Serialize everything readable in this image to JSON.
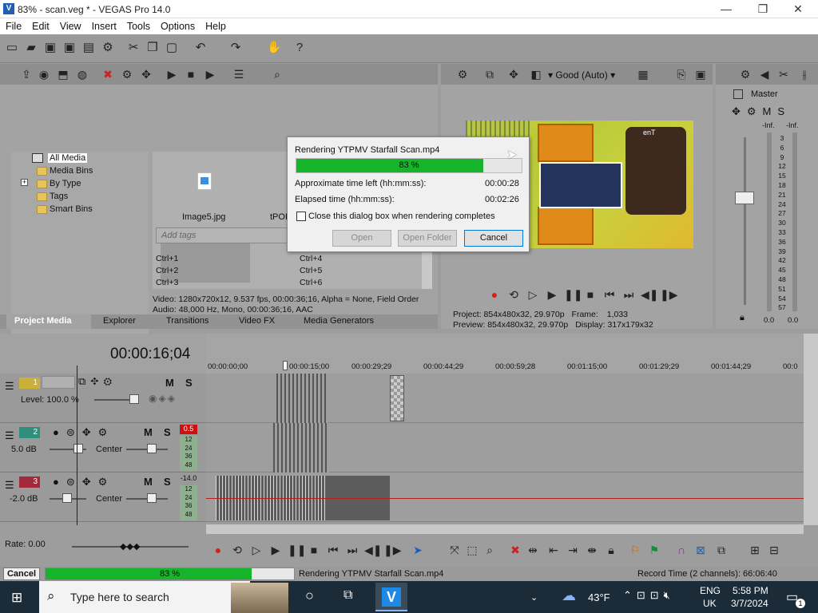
{
  "window": {
    "title": "83% - scan.veg * - VEGAS Pro 14.0",
    "minimize": "—",
    "maximize": "❐",
    "close": "✕"
  },
  "menu": [
    "File",
    "Edit",
    "View",
    "Insert",
    "Tools",
    "Options",
    "Help"
  ],
  "tree": {
    "items": [
      "All Media",
      "Media Bins",
      "By Type",
      "Tags",
      "Smart Bins"
    ],
    "expander": "+"
  },
  "media": {
    "files": [
      {
        "name": "Image5.jpg"
      },
      {
        "name": "tPOF"
      }
    ],
    "tags_placeholder": "Add tags",
    "shortcuts": [
      "Ctrl+1",
      "Ctrl+2",
      "Ctrl+3",
      "Ctrl+4",
      "Ctrl+5",
      "Ctrl+6"
    ],
    "info_video": "Video: 1280x720x12, 9.537 fps, 00:00:36;16, Alpha = None, Field Order",
    "info_audio": "Audio: 48,000 Hz, Mono, 00:00:36;16, AAC"
  },
  "left_tabs": [
    "Project Media",
    "Explorer",
    "Transitions",
    "Video FX",
    "Media Generators"
  ],
  "preview": {
    "quality": "Good (Auto)",
    "project_label": "Project:",
    "project_value": "854x480x32, 29.970p",
    "preview_label": "Preview:",
    "preview_value": "854x480x32, 29.970p",
    "frame_label": "Frame:",
    "frame_value": "1,033",
    "display_label": "Display:",
    "display_value": "317x179x32"
  },
  "master": {
    "label": "Master",
    "inf_left": "-Inf.",
    "inf_right": "-Inf.",
    "scale": [
      "3",
      "6",
      "9",
      "12",
      "15",
      "18",
      "21",
      "24",
      "27",
      "30",
      "33",
      "36",
      "39",
      "42",
      "45",
      "48",
      "51",
      "54",
      "57"
    ],
    "val_left": "0.0",
    "val_right": "0.0"
  },
  "timeline": {
    "timecode": "00:00:16;04",
    "ruler": [
      "00:00:00;00",
      "00:00:15;00",
      "00:00:29;29",
      "00:00:44;29",
      "00:00:59;28",
      "00:01:15;00",
      "00:01:29;29",
      "00:01:44;29",
      "00:0"
    ],
    "tracks": [
      {
        "num": "1",
        "color": "#c8b03a",
        "level": "Level: 100.0 %",
        "m": "M",
        "s": "S"
      },
      {
        "num": "2",
        "color": "#2f8f7a",
        "vol": "5.0 dB",
        "pan": "Center",
        "m": "M",
        "s": "S",
        "peak": "0.5",
        "peak_color": "#cc1111",
        "meter": [
          "12",
          "24",
          "36",
          "48"
        ]
      },
      {
        "num": "3",
        "color": "#a22a3a",
        "vol": "-2.0 dB",
        "pan": "Center",
        "m": "M",
        "s": "S",
        "peak": "-14.0",
        "peak_color": "#999999",
        "meter": [
          "12",
          "24",
          "36",
          "48"
        ]
      }
    ],
    "rate": "Rate: 0.00"
  },
  "status": {
    "cancel": "Cancel",
    "progress_text": "83 %",
    "progress": 0.83,
    "rendering": "Rendering YTPMV Starfall Scan.mp4",
    "record": "Record Time (2 channels): 66:06:40"
  },
  "dialog": {
    "title": "Rendering YTPMV Starfall Scan.mp4",
    "progress_text": "83 %",
    "progress": 0.83,
    "time_left_label": "Approximate time left (hh:mm:ss):",
    "time_left": "00:00:28",
    "elapsed_label": "Elapsed time (hh:mm:ss):",
    "elapsed": "00:02:26",
    "checkbox_label": "Close this dialog box when rendering completes",
    "open": "Open",
    "open_folder": "Open Folder",
    "cancel": "Cancel"
  },
  "taskbar": {
    "search_placeholder": "Type here to search",
    "weather": "43°F",
    "lang1": "ENG",
    "lang2": "UK",
    "time": "5:58 PM",
    "date": "3/7/2024",
    "notif_count": "1"
  },
  "colors": {
    "progress": "#16b42a",
    "accent": "#1e5fb5"
  }
}
